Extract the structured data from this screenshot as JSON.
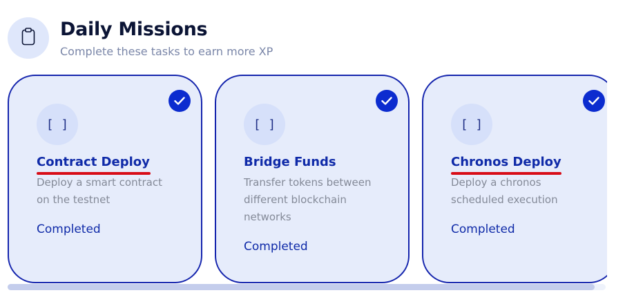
{
  "header": {
    "icon": "clipboard-icon",
    "title": "Daily Missions",
    "subtitle": "Complete these tasks to earn more XP"
  },
  "missions": [
    {
      "icon_glyph": "[ ]",
      "title": "Contract Deploy",
      "description": "Deploy a smart contract on the testnet",
      "status": "Completed",
      "completed": true
    },
    {
      "icon_glyph": "[ ]",
      "title": "Bridge Funds",
      "description": "Transfer tokens between different blockchain networks",
      "status": "Completed",
      "completed": true
    },
    {
      "icon_glyph": "[ ]",
      "title": "Chronos Deploy",
      "description": "Deploy a chronos scheduled execution",
      "status": "Completed",
      "completed": true
    }
  ],
  "colors": {
    "accent": "#0c2ccf",
    "card_border": "#1424ad",
    "card_background": "#e6ecfb",
    "title_underline": "#d80d18"
  }
}
